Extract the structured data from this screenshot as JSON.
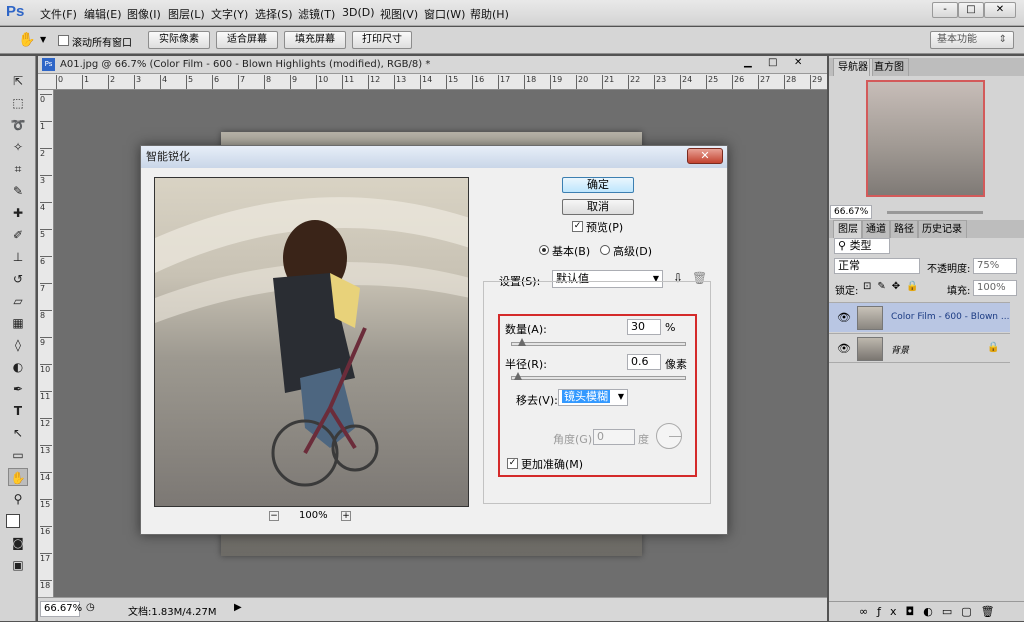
{
  "app": {
    "logo": "Ps",
    "menus": [
      "文件(F)",
      "编辑(E)",
      "图像(I)",
      "图层(L)",
      "文字(Y)",
      "选择(S)",
      "滤镜(T)",
      "3D(D)",
      "视图(V)",
      "窗口(W)",
      "帮助(H)"
    ],
    "window_controls": {
      "minimize": "-",
      "maximize": "□",
      "close": "✕"
    }
  },
  "options": {
    "scroll_all_label": "滚动所有窗口",
    "buttons": [
      "实际像素",
      "适合屏幕",
      "填充屏幕",
      "打印尺寸"
    ],
    "workspace": "基本功能"
  },
  "document": {
    "tab_title": "A01.jpg @ 66.7% (Color Film - 600 - Blown Highlights (modified), RGB/8) *",
    "ruler_top": [
      "0",
      "1",
      "2",
      "3",
      "4",
      "5",
      "6",
      "7",
      "8",
      "9",
      "10",
      "11",
      "12",
      "13",
      "14",
      "15",
      "16",
      "17",
      "18",
      "19",
      "20",
      "21",
      "22",
      "23",
      "24",
      "25",
      "26",
      "27",
      "28",
      "29"
    ],
    "ruler_left": [
      "0",
      "1",
      "2",
      "3",
      "4",
      "5",
      "6",
      "7",
      "8",
      "9",
      "10",
      "11",
      "12",
      "13",
      "14",
      "15",
      "16",
      "17",
      "18"
    ],
    "zoom": "66.67%",
    "status": "文档:1.83M/4.27M"
  },
  "navigator": {
    "tabs": [
      "导航器",
      "直方图"
    ],
    "zoom": "66.67%"
  },
  "layers": {
    "tabs": [
      "图层",
      "通道",
      "路径",
      "历史记录"
    ],
    "filter_kind": "类型",
    "blend_mode": "正常",
    "opacity_label": "不透明度:",
    "opacity": "75%",
    "lock_label": "锁定:",
    "fill_label": "填充:",
    "fill": "100%",
    "items": [
      {
        "name": "Color Film - 600 - Blown ...",
        "selected": true
      },
      {
        "name": "背景",
        "selected": false
      }
    ]
  },
  "dialog": {
    "title": "智能锐化",
    "close": "✕",
    "ok": "确定",
    "cancel": "取消",
    "preview_label": "预览(P)",
    "preview_checked": true,
    "mode_basic": "基本(B)",
    "mode_advanced": "高级(D)",
    "mode_selected": "basic",
    "settings_label": "设置(S):",
    "settings_value": "默认值",
    "amount_label": "数量(A):",
    "amount_value": "30",
    "amount_unit": "%",
    "amount_level": 0.06,
    "radius_label": "半径(R):",
    "radius_value": "0.6",
    "radius_unit": "像素",
    "radius_level": 0.04,
    "remove_label": "移去(V):",
    "remove_value": "镜头模糊",
    "angle_label": "角度(G):",
    "angle_value": "0",
    "angle_unit": "度",
    "more_accurate_label": "更加准确(M)",
    "more_accurate_checked": true,
    "preview_zoom": "100%",
    "zoom_out": "−",
    "zoom_in": "+",
    "highlight_color": "#d42a2a"
  }
}
